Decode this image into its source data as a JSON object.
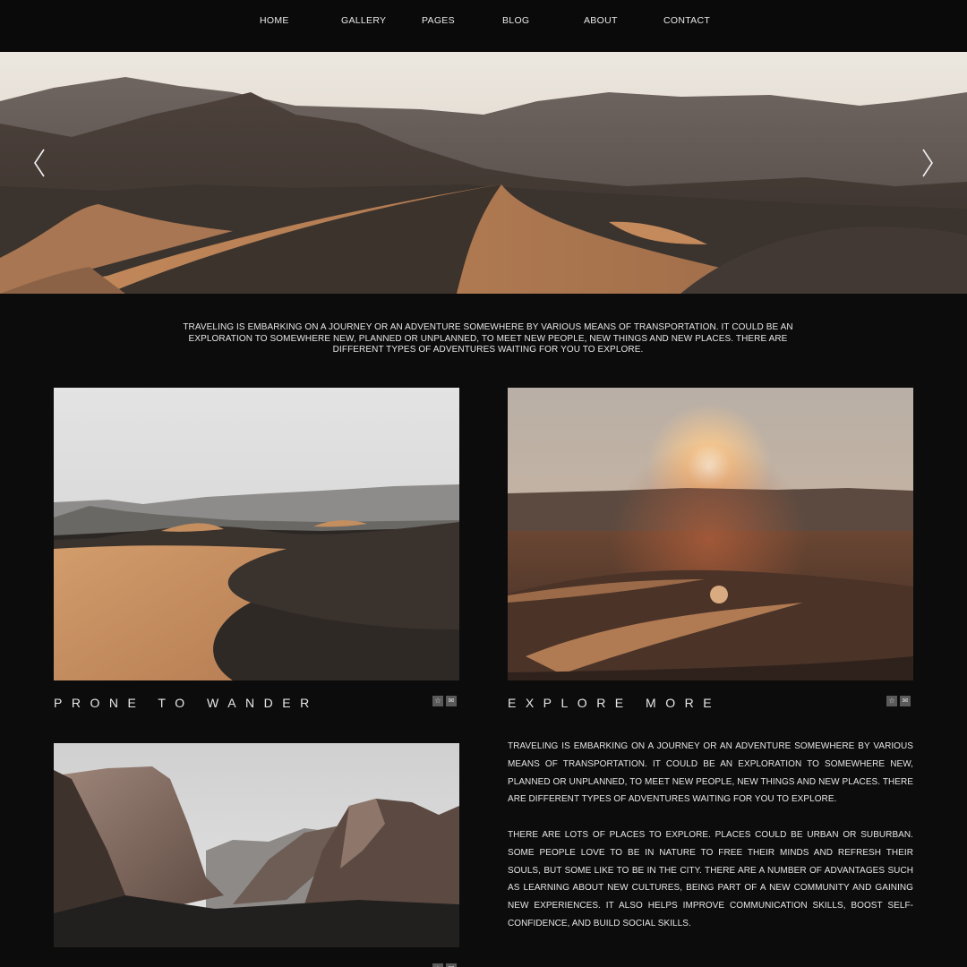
{
  "nav": {
    "items": [
      {
        "label": "HOME"
      },
      {
        "label": "GALLERY"
      },
      {
        "label": "PAGES"
      },
      {
        "label": "BLOG"
      },
      {
        "label": "ABOUT"
      },
      {
        "label": "CONTACT"
      }
    ]
  },
  "hero": {
    "prev_icon": "chevron-left-icon",
    "next_icon": "chevron-right-icon"
  },
  "intro": {
    "text": "TRAVELING IS EMBARKING ON A JOURNEY OR AN ADVENTURE SOMEWHERE BY VARIOUS MEANS OF TRANSPORTATION. IT COULD BE AN EXPLORATION TO SOMEWHERE NEW, PLANNED OR UNPLANNED, TO MEET NEW PEOPLE, NEW THINGS AND NEW PLACES. THERE ARE DIFFERENT TYPES OF ADVENTURES WAITING FOR YOU TO EXPLORE."
  },
  "cards": [
    {
      "title": "PRONE TO WANDER",
      "icons": [
        "star-icon",
        "mail-icon"
      ]
    },
    {
      "title": "EXPLORE MORE",
      "icons": [
        "star-icon",
        "mail-icon"
      ]
    },
    {
      "title": "",
      "icons": [
        "star-icon",
        "mail-icon"
      ]
    }
  ],
  "article": {
    "paragraph1": "TRAVELING IS EMBARKING ON A JOURNEY OR AN ADVENTURE SOMEWHERE BY VARIOUS MEANS OF TRANSPORTATION. IT COULD BE AN EXPLORATION TO SOMEWHERE NEW, PLANNED OR UNPLANNED, TO MEET NEW PEOPLE, NEW THINGS AND NEW PLACES. THERE ARE DIFFERENT TYPES OF ADVENTURES WAITING FOR YOU TO EXPLORE.",
    "paragraph2": "THERE ARE LOTS OF PLACES TO EXPLORE. PLACES COULD BE URBAN OR SUBURBAN. SOME PEOPLE LOVE TO BE IN NATURE TO FREE THEIR MINDS AND REFRESH THEIR SOULS, BUT SOME LIKE TO BE IN THE CITY. THERE ARE A NUMBER OF ADVANTAGES SUCH AS LEARNING ABOUT NEW CULTURES, BEING PART OF A NEW COMMUNITY AND GAINING NEW EXPERIENCES. IT ALSO HELPS IMPROVE COMMUNICATION SKILLS, BOOST SELF-CONFIDENCE, AND BUILD SOCIAL SKILLS."
  },
  "colors": {
    "background": "#0c0c0c",
    "text": "#e6e6e6",
    "sand": "#d29a6a",
    "icon_bg": "#5a5a5a"
  }
}
